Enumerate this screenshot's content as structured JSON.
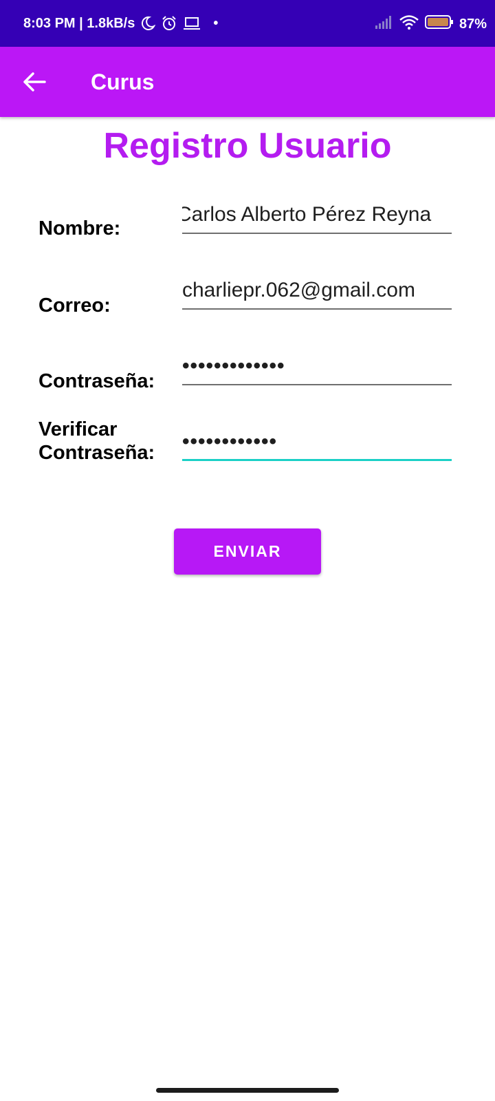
{
  "status_bar": {
    "time_speed": "8:03 PM | 1.8kB/s",
    "icons": [
      "moon-icon",
      "alarm-icon",
      "laptop-icon",
      "dot"
    ],
    "right_icons": [
      "signal-icon",
      "wifi-icon",
      "battery-icon"
    ],
    "battery": "87%",
    "background": "#3500b5"
  },
  "app_bar": {
    "title": "Curus",
    "back_icon": "arrow-left-icon",
    "background": "#bb17f6"
  },
  "form": {
    "heading": "Registro Usuario",
    "heading_color": "#b41cf0",
    "fields": [
      {
        "label": "Nombre:",
        "value": "Carlos Alberto Pérez Reyna",
        "type": "text"
      },
      {
        "label": "Correo:",
        "value": "charliepr.062@gmail.com",
        "type": "email"
      },
      {
        "label": "Contraseña:",
        "value": "•••••••••••••",
        "type": "password"
      },
      {
        "label_line1": "Verificar",
        "label_line2": "Contraseña:",
        "value": "••••••••••••",
        "type": "password",
        "focused": true,
        "focus_color": "#1bd0c6"
      }
    ],
    "submit_label": "ENVIAR",
    "submit_color": "#b718f6"
  }
}
